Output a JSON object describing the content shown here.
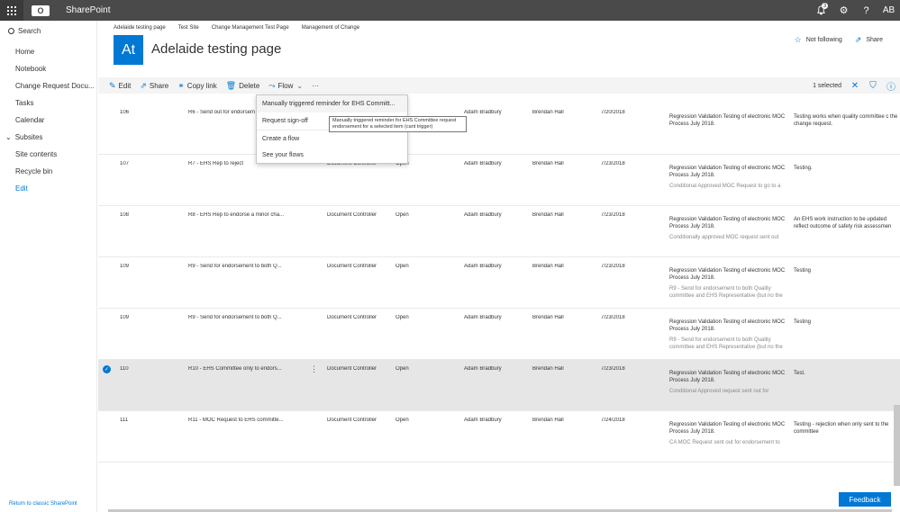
{
  "suite": {
    "app_title": "SharePoint",
    "logo_text": "O",
    "notifications_count": "3",
    "user_initials": "AB",
    "icons": [
      "waffle-icon",
      "bell-icon",
      "gear-icon",
      "help-icon"
    ]
  },
  "leftnav": {
    "search_label": "Search",
    "items": [
      "Home",
      "Notebook",
      "Change Request Docu...",
      "Tasks",
      "Calendar"
    ],
    "subsites_label": "Subsites",
    "items_after": [
      "Site contents",
      "Recycle bin"
    ],
    "edit_label": "Edit",
    "return_link": "Return to classic SharePoint"
  },
  "header": {
    "breadcrumb": [
      "Adelaide testing page",
      "Test Site",
      "Change Management Test Page",
      "Management of Change"
    ],
    "logo_initials": "At",
    "title": "Adelaide testing page",
    "not_following_label": "Not following",
    "share_label": "Share"
  },
  "cmdbar": {
    "edit": "Edit",
    "share": "Share",
    "copy_link": "Copy link",
    "delete": "Delete",
    "flow": "Flow",
    "more": "···",
    "selected_text": "1 selected"
  },
  "flow_menu": {
    "items": [
      "Manually triggered reminder for EHS Committ...",
      "Request sign-off",
      "Create a flow",
      "See your flows"
    ],
    "tooltip": "Manually triggered reminder for EHS Committee request endorsement for a selected item (cant trigger)"
  },
  "rows": [
    {
      "id": "106",
      "title": "R6 - Send out for endorsem",
      "assigned": "",
      "status": "",
      "requester": "Adam Bradbury",
      "approver": "Brendan Hall",
      "date": "7/20/2018",
      "desc": "Regression Validation Testing of electronic MOC Process July 2018.",
      "desc2": "",
      "comments": "Testing works when quality committee c the change request.",
      "selected": false
    },
    {
      "id": "107",
      "title": "R7 - EHS Rep to reject",
      "assigned": "Document Controller",
      "status": "Open",
      "requester": "Adam Bradbury",
      "approver": "Brendan Hall",
      "date": "7/23/2018",
      "desc": "Regression Validation Testing of electronic MOC Process July 2018.",
      "desc2": "Conditional Approved MOC Request to go to a",
      "comments": "Testing.",
      "selected": false
    },
    {
      "id": "108",
      "title": "R8 - EHS Rep to endorse a minor cha...",
      "assigned": "Document Controller",
      "status": "Open",
      "requester": "Adam Bradbury",
      "approver": "Brendan Hall",
      "date": "7/23/2018",
      "desc": "Regression Validation Testing of electronic MOC Process July 2018.",
      "desc2": "Conditionally approved MOC request sent out",
      "comments": "An EHS work instruction to be updated reflect outcome of safety risk assessmen",
      "selected": false
    },
    {
      "id": "109",
      "title": "R9 - Send for endorsement to both Q...",
      "assigned": "Document Controller",
      "status": "Open",
      "requester": "Adam Bradbury",
      "approver": "Brendan Hall",
      "date": "7/23/2018",
      "desc": "Regression Validation Testing of electronic MOC Process July 2018.",
      "desc2": "R9 - Send for endorsement to both Quality committee and EHS Representative (but no the",
      "comments": "Testing",
      "selected": false
    },
    {
      "id": "109",
      "title": "R9 - Send for endorsement to both Q...",
      "assigned": "Document Controller",
      "status": "Open",
      "requester": "Adam Bradbury",
      "approver": "Brendan Hall",
      "date": "7/23/2018",
      "desc": "Regression Validation Testing of electronic MOC Process July 2018.",
      "desc2": "R9 - Send for endorsement to both Quality committee and EHS Representative (but no the",
      "comments": "Testing",
      "selected": false
    },
    {
      "id": "110",
      "title": "R10 - EHS Committee only to endors...",
      "assigned": "Document Controller",
      "status": "Open",
      "requester": "Adam Bradbury",
      "approver": "Brendan Hall",
      "date": "7/23/2018",
      "desc": "Regression Validation Testing of electronic MOC Process July 2018.",
      "desc2": "Conditional Approved request sent out for",
      "comments": "Test.",
      "selected": true
    },
    {
      "id": "111",
      "title": "R11 - MOC Request to EHS committe...",
      "assigned": "Document Controller",
      "status": "Open",
      "requester": "Adam Bradbury",
      "approver": "Brendan Hall",
      "date": "7/24/2018",
      "desc": "Regression Validation Testing of electronic MOC Process July 2018.",
      "desc2": "CA MOC Request sent out for endorsement to",
      "comments": "Testing - rejection when only sent to the committee",
      "selected": false
    }
  ],
  "feedback_label": "Feedback",
  "colors": {
    "accent": "#0078d4",
    "suite_bar": "#4a4a4a",
    "selected_row": "#e6e6e6"
  }
}
